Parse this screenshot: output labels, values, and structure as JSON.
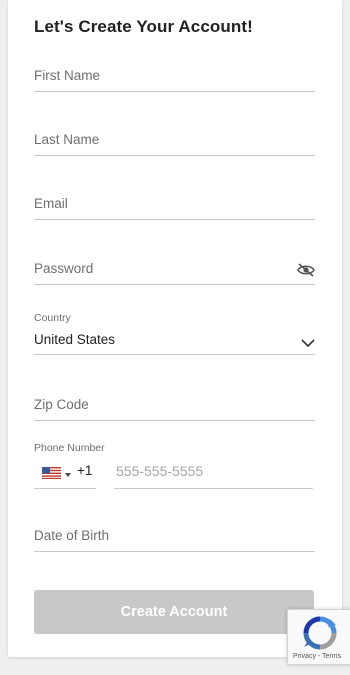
{
  "form": {
    "title": "Let's Create Your Account!",
    "first_name": {
      "placeholder": "First Name"
    },
    "last_name": {
      "placeholder": "Last Name"
    },
    "email": {
      "placeholder": "Email"
    },
    "password": {
      "placeholder": "Password",
      "icon": "eye-off-icon"
    },
    "country": {
      "label": "Country",
      "value": "United States",
      "icon": "chevron-down-icon"
    },
    "zip": {
      "placeholder": "Zip Code"
    },
    "phone": {
      "label": "Phone Number",
      "flag_icon": "us-flag-icon",
      "dial_code": "+1",
      "placeholder": "555-555-5555"
    },
    "dob": {
      "placeholder": "Date of Birth"
    },
    "submit_label": "Create Account"
  },
  "recaptcha": {
    "links": "Privacy - Terms",
    "icon": "recaptcha-logo-icon"
  },
  "colors": {
    "button_disabled": "#c8c8c8",
    "underline": "#c9c9c9",
    "text": "#222222",
    "muted": "#6f6f6f"
  }
}
